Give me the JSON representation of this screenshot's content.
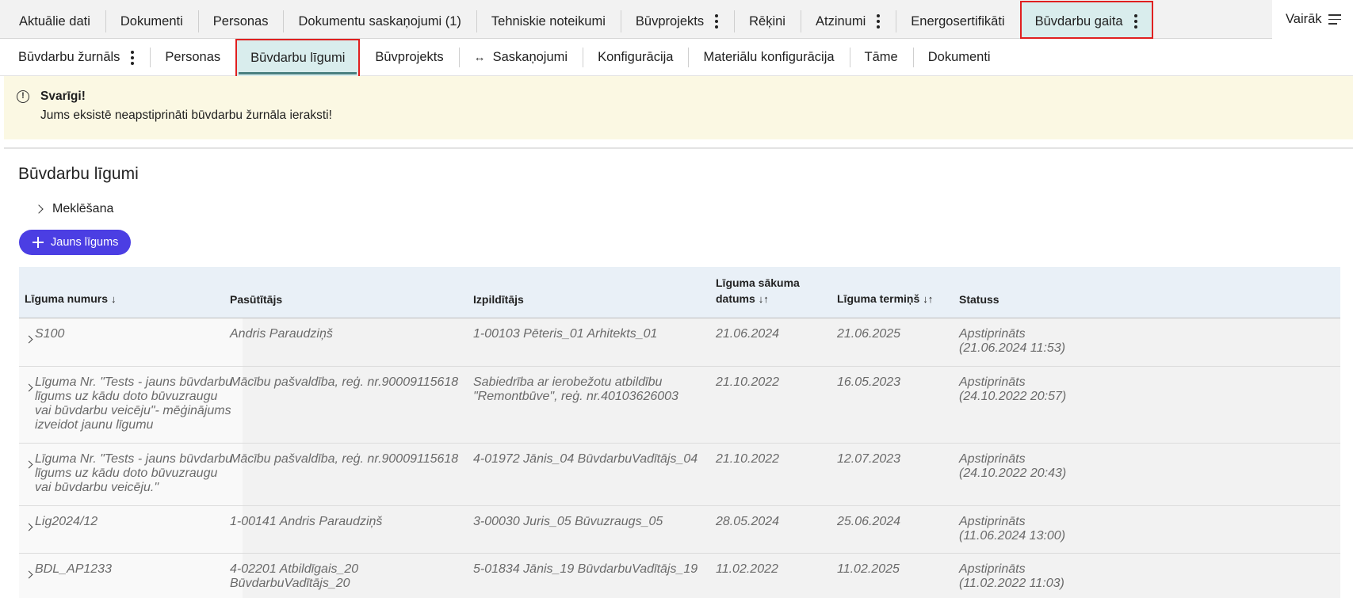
{
  "top_tabs": [
    {
      "label": "Aktuālie dati"
    },
    {
      "label": "Dokumenti"
    },
    {
      "label": "Personas"
    },
    {
      "label": "Dokumentu saskaņojumi (1)"
    },
    {
      "label": "Tehniskie noteikumi"
    },
    {
      "label": "Būvprojekts"
    },
    {
      "label": "Rēķini"
    },
    {
      "label": "Atzinumi"
    },
    {
      "label": "Energosertifikāti"
    },
    {
      "label": "Būvdarbu gaita"
    }
  ],
  "more_label": "Vairāk",
  "sub_tabs": [
    {
      "label": "Būvdarbu žurnāls"
    },
    {
      "label": "Personas"
    },
    {
      "label": "Būvdarbu līgumi"
    },
    {
      "label": "Būvprojekts"
    },
    {
      "label": "Saskaņojumi",
      "prefix": "↔"
    },
    {
      "label": "Konfigurācija"
    },
    {
      "label": "Materiālu konfigurācija"
    },
    {
      "label": "Tāme"
    },
    {
      "label": "Dokumenti"
    }
  ],
  "alert": {
    "icon": "!",
    "title": "Svarīgi!",
    "text": "Jums eksistē neapstiprināti būvdarbu žurnāla ieraksti!"
  },
  "page_title": "Būvdarbu līgumi",
  "search_label": "Meklēšana",
  "new_button_label": "Jauns līgums",
  "table": {
    "headers": {
      "number": "Līguma numurs",
      "number_sort": "↓",
      "customer": "Pasūtītājs",
      "contractor": "Izpildītājs",
      "start_line1": "Līguma sākuma",
      "start_line2": "datums",
      "start_sort": "↓↑",
      "term": "Līguma termiņš",
      "term_sort": "↓↑",
      "status": "Statuss"
    },
    "rows": [
      {
        "number": [
          "S100"
        ],
        "customer": [
          "Andris Paraudziņš"
        ],
        "contractor": [
          "1-00103 Pēteris_01 Arhitekts_01"
        ],
        "start": "21.06.2024",
        "term": "21.06.2025",
        "status": [
          "Apstiprināts",
          "(21.06.2024 11:53)"
        ]
      },
      {
        "number": [
          "Līguma Nr. \"Tests - jauns būvdarbu",
          "līgums uz kādu doto būvuzraugu",
          "vai būvdarbu veicēju\"- mēģinājums",
          "izveidot jaunu līgumu"
        ],
        "customer": [
          "Mācību pašvaldība, reģ. nr.90009115618"
        ],
        "contractor": [
          "Sabiedrība ar ierobežotu atbildību",
          "\"Remontbūve\", reģ. nr.40103626003"
        ],
        "start": "21.10.2022",
        "term": "16.05.2023",
        "status": [
          "Apstiprināts",
          "(24.10.2022 20:57)"
        ]
      },
      {
        "number": [
          "Līguma Nr. \"Tests - jauns būvdarbu",
          "līgums uz kādu doto būvuzraugu",
          "vai būvdarbu veicēju.\""
        ],
        "customer": [
          "Mācību pašvaldība, reģ. nr.90009115618"
        ],
        "contractor": [
          "4-01972 Jānis_04 BūvdarbuVadītājs_04"
        ],
        "start": "21.10.2022",
        "term": "12.07.2023",
        "status": [
          "Apstiprināts",
          "(24.10.2022 20:43)"
        ]
      },
      {
        "number": [
          "Lig2024/12"
        ],
        "customer": [
          "1-00141 Andris Paraudziņš"
        ],
        "contractor": [
          "3-00030 Juris_05 Būvuzraugs_05"
        ],
        "start": "28.05.2024",
        "term": "25.06.2024",
        "status": [
          "Apstiprināts",
          "(11.06.2024 13:00)"
        ]
      },
      {
        "number": [
          "BDL_AP1233"
        ],
        "customer": [
          "4-02201 Atbildīgais_20",
          "BūvdarbuVadītājs_20"
        ],
        "contractor": [
          "5-01834 Jānis_19 BūvdarbuVadītājs_19"
        ],
        "start": "11.02.2022",
        "term": "11.02.2025",
        "status": [
          "Apstiprināts",
          "(11.02.2022 11:03)"
        ]
      }
    ]
  },
  "colors": {
    "accent_button": "#4b3ee3",
    "active_tab_bg": "#d9eded",
    "highlight_border": "#e02020",
    "alert_bg": "#fbf8e3",
    "header_bg": "#e9f0f7"
  }
}
